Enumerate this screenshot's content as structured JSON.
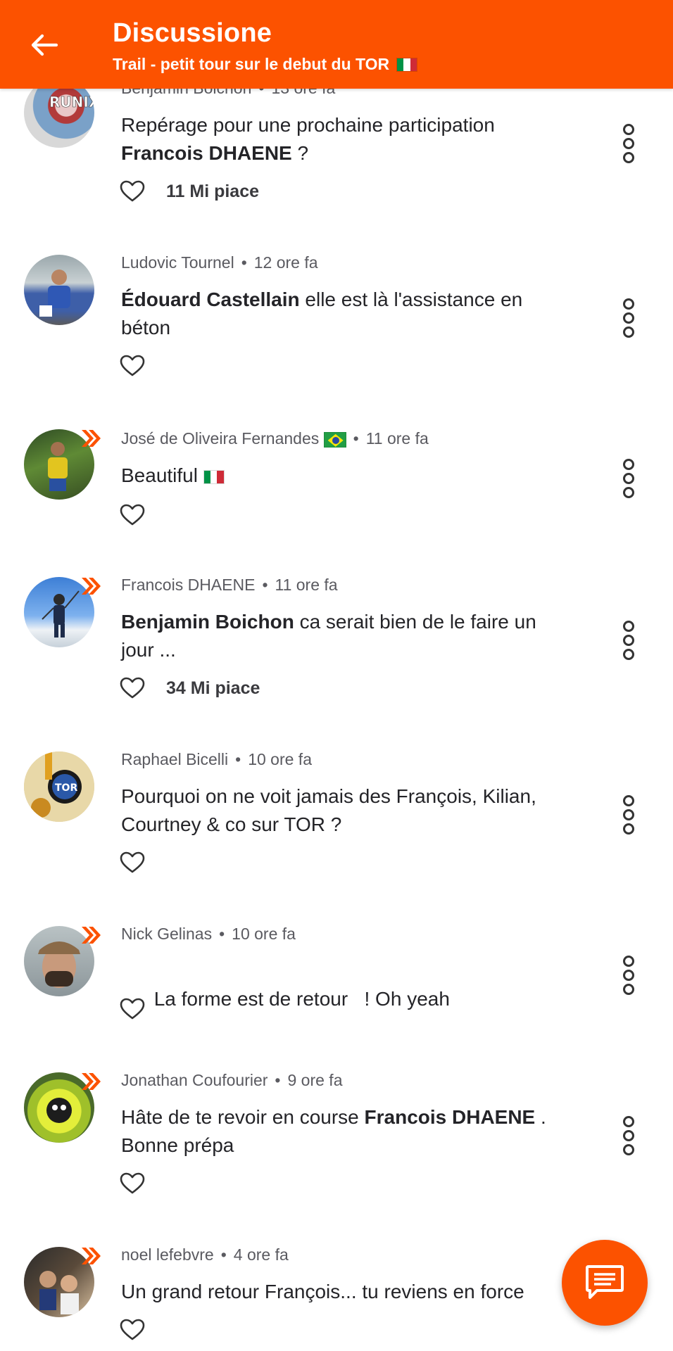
{
  "header": {
    "title": "Discussione",
    "subtitle": "Trail - petit tour sur le debut du TOR"
  },
  "comments": [
    {
      "author": "Benjamin Boichon",
      "time": "13 ore fa",
      "text_parts": [
        {
          "t": "Repérage pour une prochaine participation ",
          "b": false
        },
        {
          "t": "Francois DHAENE",
          "b": true
        },
        {
          "t": " ?",
          "b": false
        }
      ],
      "likes": "11 Mi piace"
    },
    {
      "author": "Ludovic Tournel",
      "time": "12 ore fa",
      "text_parts": [
        {
          "t": "Édouard Castellain",
          "b": true
        },
        {
          "t": " elle est là l'assistance en béton",
          "b": false
        }
      ],
      "likes": ""
    },
    {
      "author": "José de Oliveira Fernandes",
      "time": "11 ore fa",
      "text_parts": [
        {
          "t": "Beautiful",
          "b": false
        }
      ],
      "likes": ""
    },
    {
      "author": "Francois DHAENE",
      "time": "11 ore fa",
      "text_parts": [
        {
          "t": "Benjamin Boichon",
          "b": true
        },
        {
          "t": " ca serait bien de le faire un jour ...",
          "b": false
        }
      ],
      "likes": "34 Mi piace"
    },
    {
      "author": "Raphael Bicelli",
      "time": "10 ore fa",
      "text_parts": [
        {
          "t": "Pourquoi on ne voit jamais des François, Kilian, Courtney & co sur TOR ?",
          "b": false
        }
      ],
      "likes": ""
    },
    {
      "author": "Nick Gelinas",
      "time": "10 ore fa",
      "text_parts": [
        {
          "t": "La forme est de retour   ! Oh yeah",
          "b": false
        }
      ],
      "likes": ""
    },
    {
      "author": "Jonathan Coufourier",
      "time": "9 ore fa",
      "text_parts": [
        {
          "t": "Hâte de te revoir en course ",
          "b": false
        },
        {
          "t": "Francois DHAENE",
          "b": true
        },
        {
          "t": " . Bonne prépa",
          "b": false
        }
      ],
      "likes": ""
    },
    {
      "author": "noel lefebvre",
      "time": "4 ore fa",
      "text_parts": [
        {
          "t": "Un grand retour François... tu reviens en force",
          "b": false
        }
      ],
      "likes": ""
    }
  ],
  "icons": {
    "back": "arrow-left-icon",
    "like": "heart-outline-icon",
    "more": "more-vertical-icon",
    "fab": "comment-bubble-icon",
    "badge": "double-chevron-icon"
  },
  "colors": {
    "accent": "#fc5200",
    "text": "#242428",
    "meta": "#5a5a60"
  }
}
